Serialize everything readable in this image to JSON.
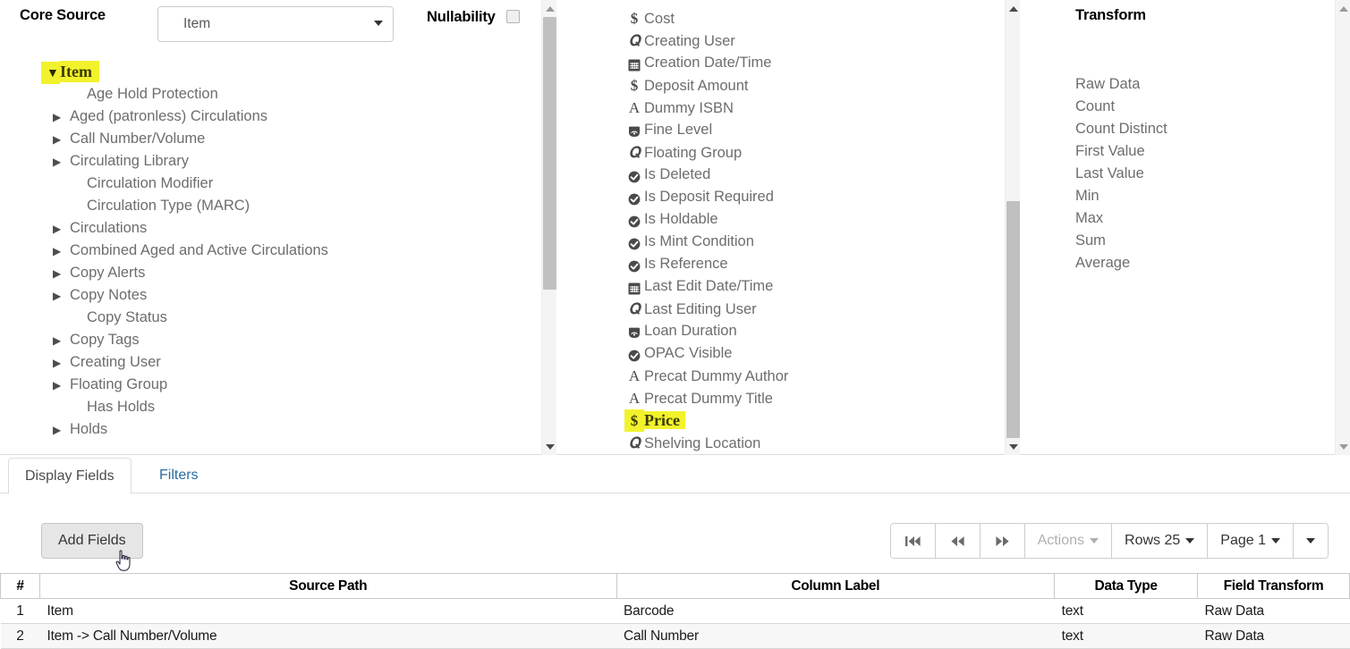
{
  "header": {
    "core_source_label": "Core Source",
    "core_source_value": "Item",
    "nullability_label": "Nullability",
    "nullability_checked": false,
    "transform_label": "Transform"
  },
  "tree": {
    "root": {
      "label": "Item",
      "expanded": true,
      "highlighted": true
    },
    "items": [
      {
        "label": "Age Hold Protection",
        "expandable": false
      },
      {
        "label": "Aged (patronless) Circulations",
        "expandable": true
      },
      {
        "label": "Call Number/Volume",
        "expandable": true
      },
      {
        "label": "Circulating Library",
        "expandable": true
      },
      {
        "label": "Circulation Modifier",
        "expandable": false
      },
      {
        "label": "Circulation Type (MARC)",
        "expandable": false
      },
      {
        "label": "Circulations",
        "expandable": true
      },
      {
        "label": "Combined Aged and Active Circulations",
        "expandable": true
      },
      {
        "label": "Copy Alerts",
        "expandable": true
      },
      {
        "label": "Copy Notes",
        "expandable": true
      },
      {
        "label": "Copy Status",
        "expandable": false
      },
      {
        "label": "Copy Tags",
        "expandable": true
      },
      {
        "label": "Creating User",
        "expandable": true
      },
      {
        "label": "Floating Group",
        "expandable": true
      },
      {
        "label": "Has Holds",
        "expandable": false
      },
      {
        "label": "Holds",
        "expandable": true
      }
    ]
  },
  "fields": [
    {
      "label": "Cost",
      "icon": "money-icon",
      "highlighted": false
    },
    {
      "label": "Creating User",
      "icon": "link-icon",
      "highlighted": false
    },
    {
      "label": "Creation Date/Time",
      "icon": "calendar-icon",
      "highlighted": false
    },
    {
      "label": "Deposit Amount",
      "icon": "money-icon",
      "highlighted": false
    },
    {
      "label": "Dummy ISBN",
      "icon": "text-icon",
      "highlighted": false
    },
    {
      "label": "Fine Level",
      "icon": "gauge-icon",
      "highlighted": false
    },
    {
      "label": "Floating Group",
      "icon": "link-icon",
      "highlighted": false
    },
    {
      "label": "Is Deleted",
      "icon": "bool-check-icon",
      "highlighted": false
    },
    {
      "label": "Is Deposit Required",
      "icon": "bool-check-icon",
      "highlighted": false
    },
    {
      "label": "Is Holdable",
      "icon": "bool-check-icon",
      "highlighted": false
    },
    {
      "label": "Is Mint Condition",
      "icon": "bool-check-icon",
      "highlighted": false
    },
    {
      "label": "Is Reference",
      "icon": "bool-check-icon",
      "highlighted": false
    },
    {
      "label": "Last Edit Date/Time",
      "icon": "calendar-icon",
      "highlighted": false
    },
    {
      "label": "Last Editing User",
      "icon": "link-icon",
      "highlighted": false
    },
    {
      "label": "Loan Duration",
      "icon": "gauge-icon",
      "highlighted": false
    },
    {
      "label": "OPAC Visible",
      "icon": "bool-check-icon",
      "highlighted": false
    },
    {
      "label": "Precat Dummy Author",
      "icon": "text-icon",
      "highlighted": false
    },
    {
      "label": "Precat Dummy Title",
      "icon": "text-icon",
      "highlighted": false
    },
    {
      "label": "Price",
      "icon": "money-icon",
      "highlighted": true
    },
    {
      "label": "Shelving Location",
      "icon": "link-icon",
      "highlighted": false
    }
  ],
  "transforms": [
    "Raw Data",
    "Count",
    "Count Distinct",
    "First Value",
    "Last Value",
    "Min",
    "Max",
    "Sum",
    "Average"
  ],
  "tabs": {
    "display_fields": "Display Fields",
    "filters": "Filters",
    "active": "Display Fields"
  },
  "toolbar": {
    "add_fields_label": "Add Fields",
    "first_page_icon": "first-page-icon",
    "prev_page_icon": "previous-page-icon",
    "next_page_icon": "next-page-icon",
    "actions_label": "Actions",
    "actions_disabled": true,
    "rows_label": "Rows 25",
    "page_label": "Page 1",
    "more_icon": "chevron-down-icon"
  },
  "grid": {
    "columns": [
      "#",
      "Source Path",
      "Column Label",
      "Data Type",
      "Field Transform"
    ],
    "rows": [
      {
        "num": "1",
        "source_path": "Item",
        "column_label": "Barcode",
        "data_type": "text",
        "field_transform": "Raw Data"
      },
      {
        "num": "2",
        "source_path": "Item -> Call Number/Volume",
        "column_label": "Call Number",
        "data_type": "text",
        "field_transform": "Raw Data"
      }
    ]
  },
  "colors": {
    "highlight": "#f2f22c",
    "link": "#2b6ca3",
    "muted_text": "#6d6d6d"
  }
}
